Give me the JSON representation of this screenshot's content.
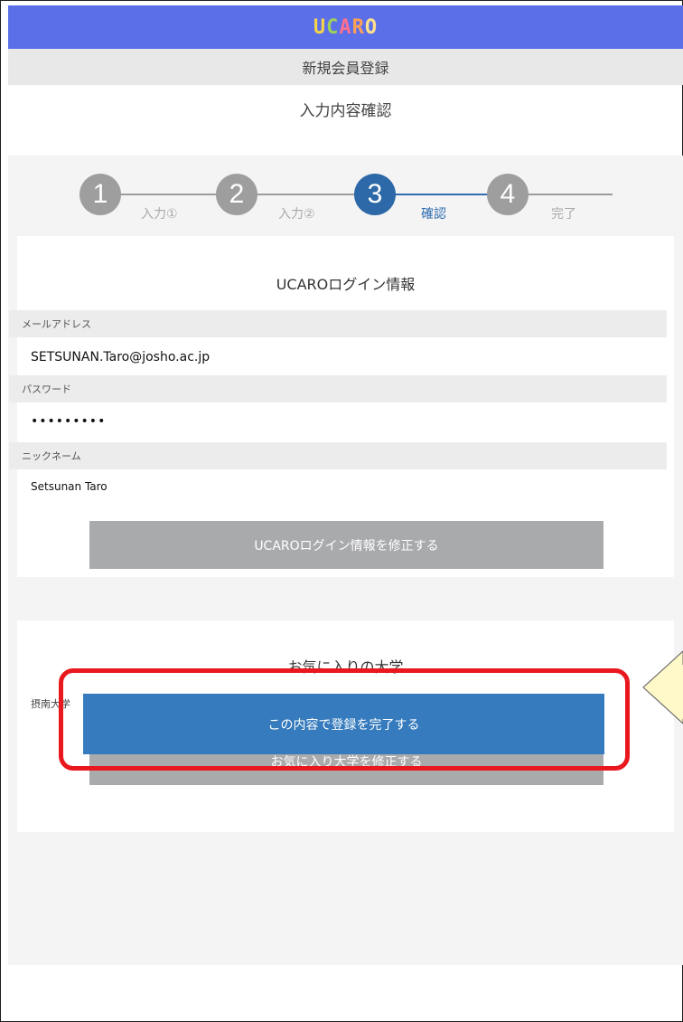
{
  "header": {
    "logo": [
      "U",
      "C",
      "A",
      "R",
      "O"
    ],
    "subtitle": "新規会員登録"
  },
  "page": {
    "title": "入力内容確認"
  },
  "stepper": {
    "steps": [
      {
        "number": "1",
        "label": "入力①"
      },
      {
        "number": "2",
        "label": "入力②"
      },
      {
        "number": "3",
        "label": "確認"
      },
      {
        "number": "4",
        "label": "完了"
      }
    ],
    "current_step": 3
  },
  "login_card": {
    "title": "UCAROログイン情報",
    "fields": [
      {
        "label": "メールアドレス",
        "value": "SETSUNAN.Taro@josho.ac.jp"
      },
      {
        "label": "パスワード",
        "value": "•••••••••"
      },
      {
        "label": "ニックネーム",
        "value": "Setsunan Taro"
      }
    ],
    "edit_button": "UCAROログイン情報を修正する"
  },
  "favorite_card": {
    "title": "お気に入りの大学",
    "university": "摂南大学",
    "edit_button": "お気に入り大学を修正する"
  },
  "submit_button": "この内容で登録を完了する",
  "colors": {
    "topbar": "#5b6fe8",
    "active_step": "#2d68a8",
    "submit": "#357bbd",
    "highlight": "#e8181e"
  }
}
